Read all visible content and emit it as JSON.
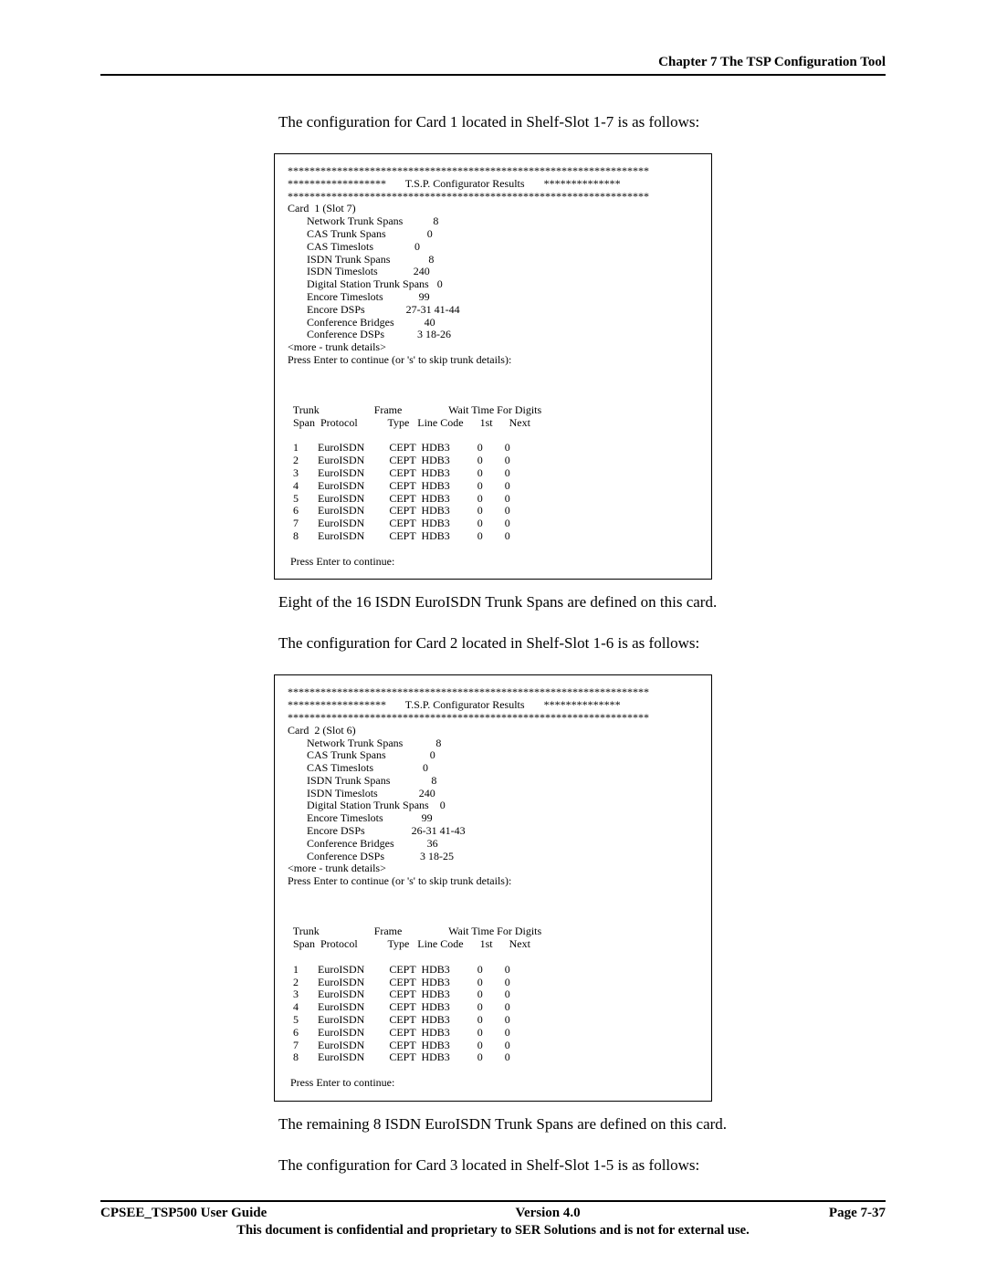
{
  "header": {
    "chapter": "Chapter 7 The TSP Configuration Tool"
  },
  "para1": "The configuration for Card 1 located in Shelf-Slot 1-7 is as follows:",
  "terminal1": "******************************************************************\n******************       T.S.P. Configurator Results       **************\n******************************************************************\nCard  1 (Slot 7)\n       Network Trunk Spans           8\n       CAS Trunk Spans               0\n       CAS Timeslots               0\n       ISDN Trunk Spans              8\n       ISDN Timeslots             240\n       Digital Station Trunk Spans   0\n       Encore Timeslots             99\n       Encore DSPs               27-31 41-44\n       Conference Bridges           40\n       Conference DSPs            3 18-26\n<more - trunk details>\nPress Enter to continue (or 's' to skip trunk details):\n\n\n\n  Trunk                    Frame                 Wait Time For Digits\n  Span  Protocol           Type   Line Code      1st      Next\n\n  1       EuroISDN         CEPT  HDB3          0        0\n  2       EuroISDN         CEPT  HDB3          0        0\n  3       EuroISDN         CEPT  HDB3          0        0\n  4       EuroISDN         CEPT  HDB3          0        0\n  5       EuroISDN         CEPT  HDB3          0        0\n  6       EuroISDN         CEPT  HDB3          0        0\n  7       EuroISDN         CEPT  HDB3          0        0\n  8       EuroISDN         CEPT  HDB3          0        0\n\n Press Enter to continue:",
  "para2": "Eight of the 16 ISDN EuroISDN Trunk Spans are defined on this card.",
  "para3": "The configuration for Card 2 located in Shelf-Slot 1-6 is as follows:",
  "terminal2": "******************************************************************\n******************       T.S.P. Configurator Results       **************\n******************************************************************\nCard  2 (Slot 6)\n       Network Trunk Spans            8\n       CAS Trunk Spans                0\n       CAS Timeslots                  0\n       ISDN Trunk Spans               8\n       ISDN Timeslots               240\n       Digital Station Trunk Spans    0\n       Encore Timeslots              99\n       Encore DSPs                 26-31 41-43\n       Conference Bridges            36\n       Conference DSPs             3 18-25\n<more - trunk details>\nPress Enter to continue (or 's' to skip trunk details):\n\n\n\n  Trunk                    Frame                 Wait Time For Digits\n  Span  Protocol           Type   Line Code      1st      Next\n\n  1       EuroISDN         CEPT  HDB3          0        0\n  2       EuroISDN         CEPT  HDB3          0        0\n  3       EuroISDN         CEPT  HDB3          0        0\n  4       EuroISDN         CEPT  HDB3          0        0\n  5       EuroISDN         CEPT  HDB3          0        0\n  6       EuroISDN         CEPT  HDB3          0        0\n  7       EuroISDN         CEPT  HDB3          0        0\n  8       EuroISDN         CEPT  HDB3          0        0\n\n Press Enter to continue:",
  "para4": "The remaining 8 ISDN EuroISDN Trunk Spans are defined on this card.",
  "para5": "The configuration for Card 3 located in Shelf-Slot 1-5 is as follows:",
  "footer": {
    "left": "CPSEE_TSP500 User Guide",
    "center": "Version 4.0",
    "right": "Page 7-37",
    "note": "This document is confidential and proprietary to SER Solutions and is not for external use."
  }
}
